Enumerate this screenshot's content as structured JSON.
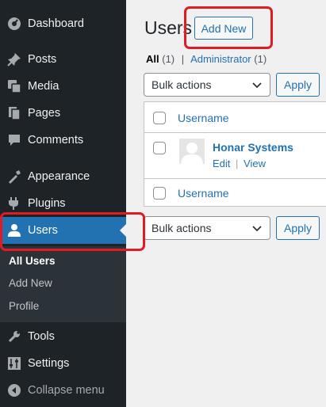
{
  "sidebar": {
    "items": [
      {
        "label": "Dashboard",
        "icon": "dashboard-icon"
      },
      {
        "label": "Posts",
        "icon": "pin-icon"
      },
      {
        "label": "Media",
        "icon": "media-icon"
      },
      {
        "label": "Pages",
        "icon": "pages-icon"
      },
      {
        "label": "Comments",
        "icon": "comments-icon"
      },
      {
        "label": "Appearance",
        "icon": "appearance-icon"
      },
      {
        "label": "Plugins",
        "icon": "plugins-icon"
      },
      {
        "label": "Users",
        "icon": "users-icon",
        "current": true
      },
      {
        "label": "Tools",
        "icon": "tools-icon"
      },
      {
        "label": "Settings",
        "icon": "settings-icon"
      },
      {
        "label": "Collapse menu",
        "icon": "collapse-icon"
      }
    ],
    "submenu": [
      {
        "label": "All Users",
        "active": true
      },
      {
        "label": "Add New"
      },
      {
        "label": "Profile"
      }
    ]
  },
  "main": {
    "title": "Users",
    "add_new_label": "Add New",
    "filters": {
      "all_label": "All",
      "all_count": "(1)",
      "separator": "|",
      "admin_label": "Administrator",
      "admin_count": "(1)"
    },
    "bulk_actions": {
      "selected": "Bulk actions",
      "apply_label": "Apply"
    },
    "table": {
      "column_header": "Username",
      "rows": [
        {
          "username": "Honar Systems",
          "actions": [
            "Edit",
            "View"
          ],
          "action_sep": "|"
        }
      ],
      "column_footer": "Username"
    }
  },
  "colors": {
    "sidebar_bg": "#1d2327",
    "accent": "#2271b1",
    "annotation": "#e01b24"
  }
}
